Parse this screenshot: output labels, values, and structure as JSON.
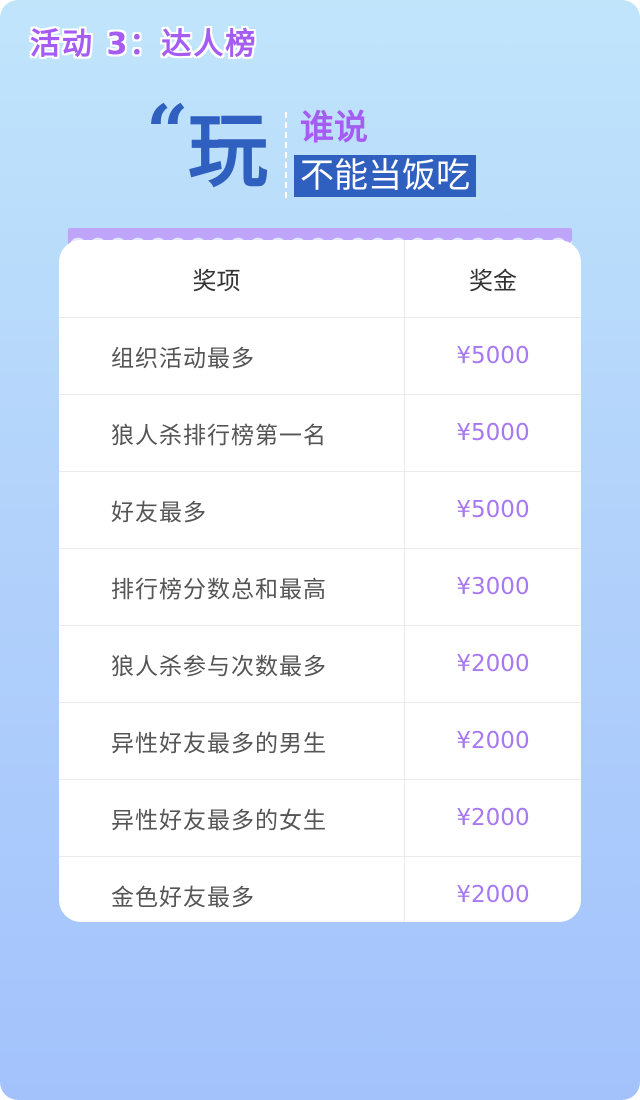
{
  "activity": {
    "title": "活动 3：达人榜"
  },
  "slogan": {
    "quote_mark": "“",
    "big_char": "玩",
    "line1": "谁说",
    "line2": "不能当饭吃"
  },
  "table": {
    "headers": {
      "item": "奖项",
      "amount": "奖金"
    },
    "rows": [
      {
        "name": "组织活动最多",
        "amount": "¥5000"
      },
      {
        "name": "狼人杀排行榜第一名",
        "amount": "¥5000"
      },
      {
        "name": "好友最多",
        "amount": "¥5000"
      },
      {
        "name": "排行榜分数总和最高",
        "amount": "¥3000"
      },
      {
        "name": "狼人杀参与次数最多",
        "amount": "¥2000"
      },
      {
        "name": "异性好友最多的男生",
        "amount": "¥2000"
      },
      {
        "name": "异性好友最多的女生",
        "amount": "¥2000"
      },
      {
        "name": "金色好友最多",
        "amount": "¥2000"
      }
    ]
  },
  "colors": {
    "accent_purple": "#a45cf2",
    "brand_blue": "#2f5fbf",
    "amount_purple": "#a779f0",
    "background_top": "#c0e5fb",
    "background_bottom": "#a3c2fc"
  }
}
